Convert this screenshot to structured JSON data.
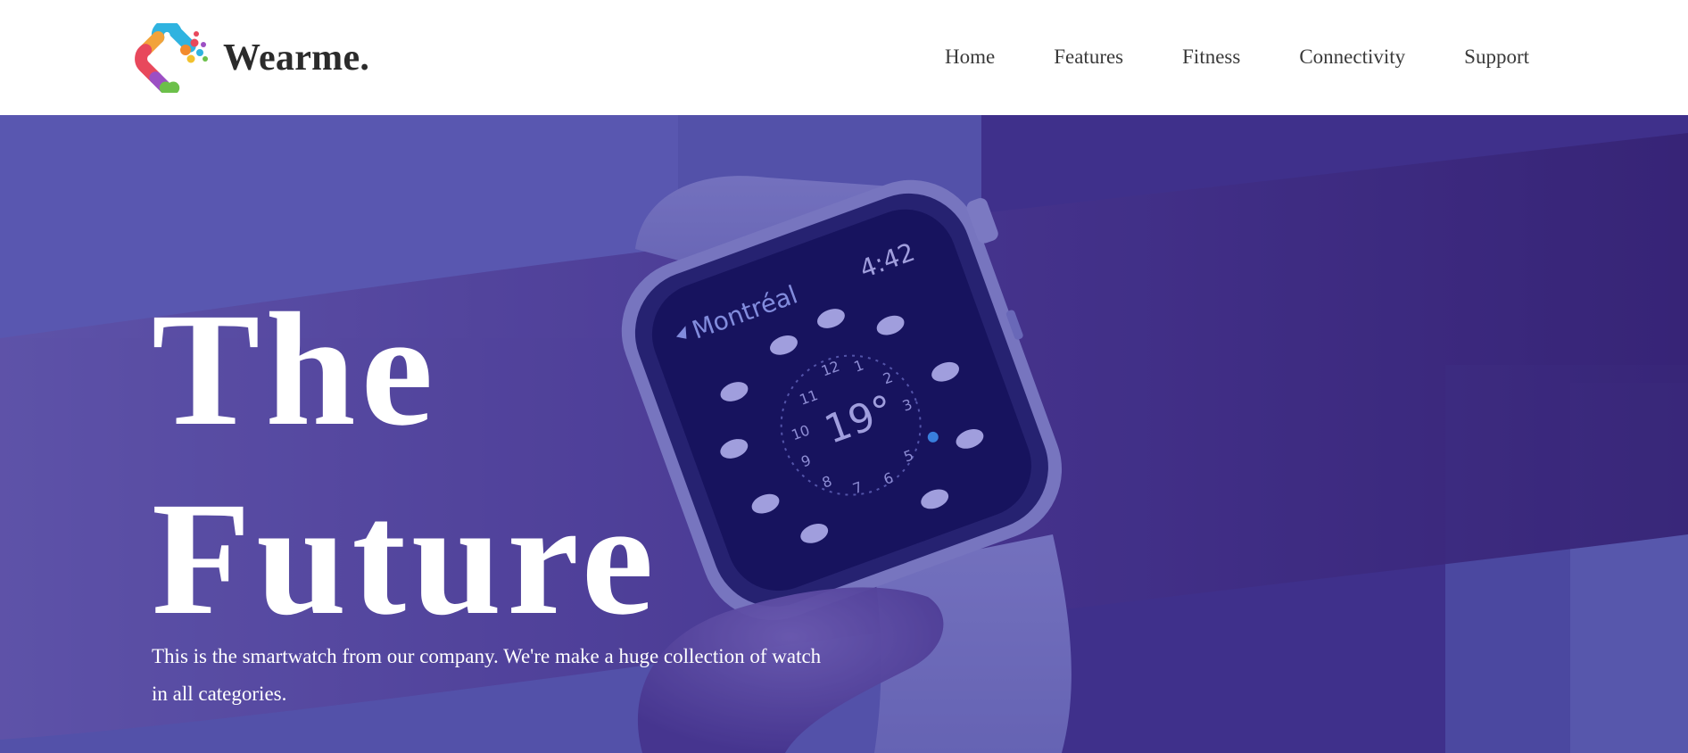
{
  "brand": {
    "name": "Wearme.",
    "logo_icon": "colorful-c-logo-icon"
  },
  "nav": {
    "items": [
      {
        "label": "Home"
      },
      {
        "label": "Features"
      },
      {
        "label": "Fitness"
      },
      {
        "label": "Connectivity"
      },
      {
        "label": "Support"
      }
    ]
  },
  "hero": {
    "title_line1": "The",
    "title_line2": "Future",
    "description": "This is the smartwatch from our company. We're make a huge collection of watch in all categories.",
    "overlay_color": "#3b2a86",
    "watch": {
      "city": "Montréal",
      "time": "4:42",
      "temperature": "19°",
      "dial_numbers": [
        "12",
        "1",
        "2",
        "3",
        "5",
        "6",
        "7",
        "8",
        "9",
        "10",
        "11"
      ]
    }
  },
  "colors": {
    "header_bg": "#ffffff",
    "text_dark": "#2b2b2b",
    "hero_text": "#ffffff"
  }
}
